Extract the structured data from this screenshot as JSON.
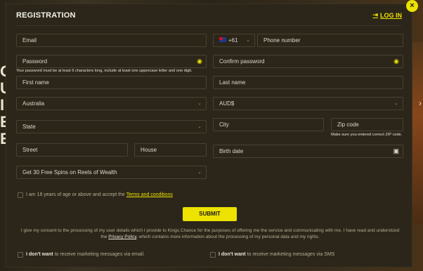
{
  "background": {
    "left_text": "O\nU\nI\nE\nE\nC",
    "right_icon": "chevron-right-icon"
  },
  "modal": {
    "title": "REGISTRATION",
    "login_label": "LOG IN",
    "close_label": "×"
  },
  "fields": {
    "email_placeholder": "Email",
    "country_code": "+61",
    "phone_placeholder": "Phone number",
    "password_placeholder": "Password",
    "confirm_password_placeholder": "Confirm password",
    "password_hint": "Your password must be at least 6 characters long, include at least one uppercase letter and one digit.",
    "first_name_placeholder": "First name",
    "last_name_placeholder": "Last name",
    "country_value": "Australia",
    "currency_value": "AUD$",
    "state_placeholder": "State",
    "city_placeholder": "City",
    "zip_placeholder": "Zip code",
    "zip_hint": "Make sure you entered correct ZIP code.",
    "street_placeholder": "Street",
    "house_placeholder": "House",
    "birth_date_placeholder": "Birth date",
    "bonus_value": "Get 30 Free Spins on Reels of Wealth"
  },
  "age_checkbox": {
    "text": "I am 18 years of age or above and accept the",
    "link": "Terms and conditions"
  },
  "submit_label": "SUBMIT",
  "consent": {
    "text_before": "I give my consent to the processing of my user details which I provide to Kings Chance for the purposes of offering me the service and communicating with me. I have read and understood the",
    "link": "Privacy Policy",
    "text_after": ", which contains more information about the processing of my personal data and my rights."
  },
  "marketing": {
    "email_bold": "I don't want",
    "email_text": "to receive marketing messages via email.",
    "sms_bold": "I don't want",
    "sms_text": "to receive marketing messages via SMS"
  },
  "colors": {
    "accent": "#ede200",
    "modal_bg": "#2b2619",
    "border": "#4a4230"
  }
}
